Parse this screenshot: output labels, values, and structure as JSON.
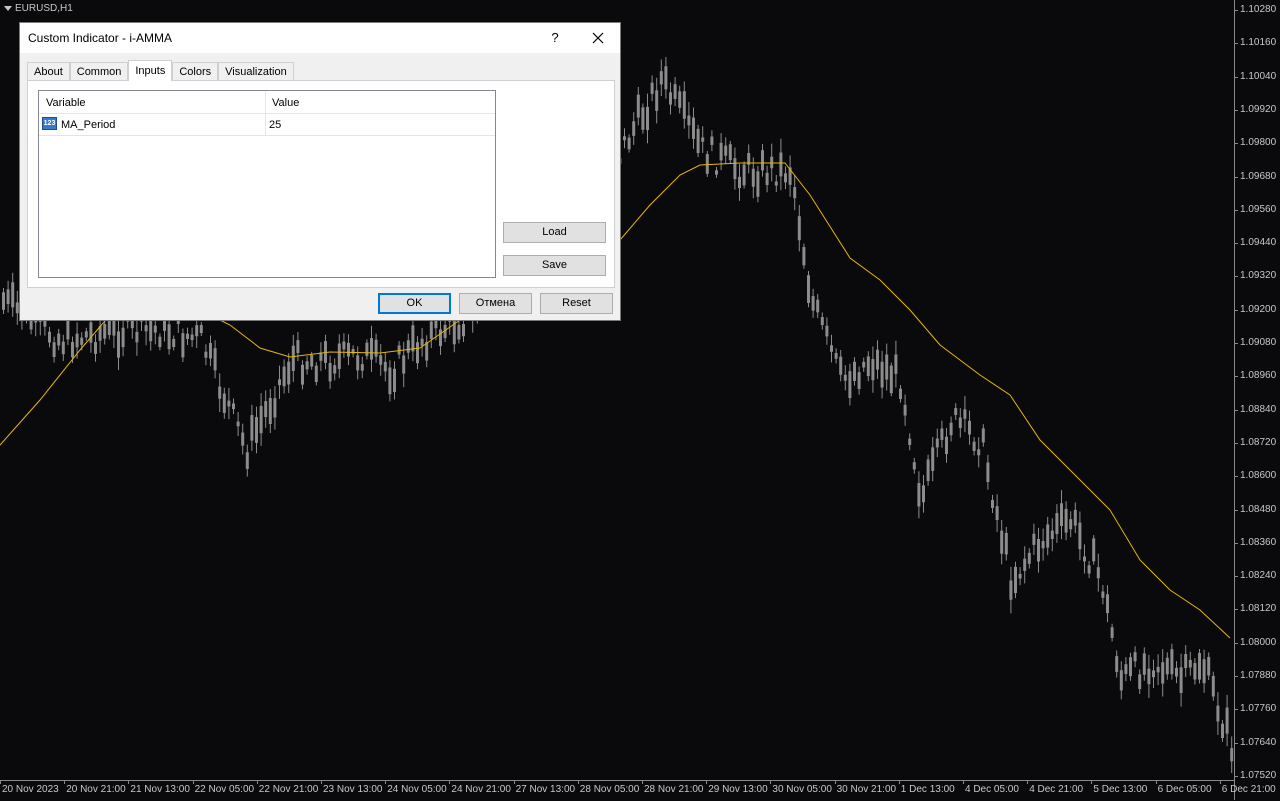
{
  "chart": {
    "symbol": "EURUSD,H1",
    "colors": {
      "background": "#0a0a0d",
      "candle": "#8c8c8c",
      "ma_line": "#e6b800",
      "axis_text": "#c8c8c8"
    },
    "price_axis": [
      "1.10280",
      "1.10160",
      "1.10040",
      "1.09920",
      "1.09800",
      "1.09680",
      "1.09560",
      "1.09440",
      "1.09320",
      "1.09200",
      "1.09080",
      "1.08960",
      "1.08840",
      "1.08720",
      "1.08600",
      "1.08480",
      "1.08360",
      "1.08240",
      "1.08120",
      "1.08000",
      "1.07880",
      "1.07760",
      "1.07640",
      "1.07520"
    ],
    "time_axis": [
      "20 Nov 2023",
      "20 Nov 21:00",
      "21 Nov 13:00",
      "22 Nov 05:00",
      "22 Nov 21:00",
      "23 Nov 13:00",
      "24 Nov 05:00",
      "24 Nov 21:00",
      "27 Nov 13:00",
      "28 Nov 05:00",
      "28 Nov 21:00",
      "29 Nov 13:00",
      "30 Nov 05:00",
      "30 Nov 21:00",
      "1 Dec 13:00",
      "4 Dec 05:00",
      "4 Dec 21:00",
      "5 Dec 13:00",
      "6 Dec 05:00",
      "6 Dec 21:00"
    ]
  },
  "dialog": {
    "title": "Custom Indicator - i-AMMA",
    "help_label": "?",
    "tabs": [
      "About",
      "Common",
      "Inputs",
      "Colors",
      "Visualization"
    ],
    "active_tab": "Inputs",
    "table": {
      "headers": [
        "Variable",
        "Value"
      ],
      "rows": [
        {
          "icon": "number-icon",
          "icon_text": "123",
          "variable": "MA_Period",
          "value": "25"
        }
      ]
    },
    "buttons": {
      "load": "Load",
      "save": "Save",
      "ok": "OK",
      "cancel": "Отмена",
      "reset": "Reset"
    }
  }
}
